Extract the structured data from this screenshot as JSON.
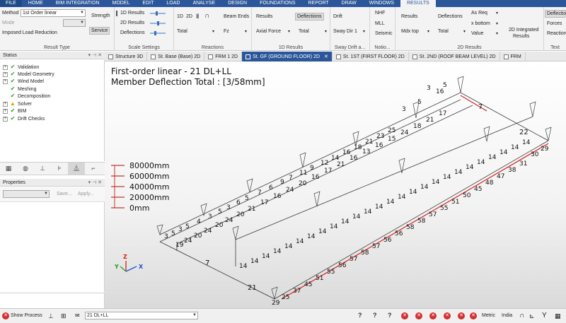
{
  "menu": [
    "FILE",
    "HOME",
    "BIM INTEGRATION",
    "MODEL",
    "EDIT",
    "LOAD",
    "ANALYSE",
    "DESIGN",
    "FOUNDATIONS",
    "REPORT",
    "DRAW",
    "WINDOWS",
    "RESULTS"
  ],
  "ribbon": {
    "result_type": {
      "method_label": "Method",
      "method_value": "1st Order linear",
      "mode_label": "Mode",
      "imposed_label": "Imposed Load Reduction",
      "strength": "Strength",
      "service": "Service",
      "group": "Result Type"
    },
    "scale": {
      "r1d": "1D Results",
      "r2d": "2D Results",
      "defl": "Deflections",
      "group": "Scale Settings"
    },
    "reactions": {
      "b1d": "1D",
      "b2d": "2D",
      "beam_ends": "Beam Ends",
      "total": "Total",
      "fz": "Fz",
      "group": "Reactions"
    },
    "res1d": {
      "results": "Results",
      "axial": "Axial Force",
      "deflections": "Deflections",
      "total": "Total",
      "group": "1D Results"
    },
    "drift": {
      "drift": "Drift",
      "sway": "Sway Dir 1",
      "group": "Sway Drift a..."
    },
    "notio": {
      "nhf": "NHF",
      "mll": "MLL",
      "seismic": "Seismic",
      "group": "Notio..."
    },
    "res2d": {
      "results": "Results",
      "mdx": "Mdx top",
      "deflections": "Deflections",
      "total": "Total",
      "as_req": "As Req",
      "xbottom": "x bottom",
      "value": "Value",
      "integrated": "2D Integrated",
      "integrated2": "Results",
      "group": "2D Results"
    },
    "text": {
      "deflections": "Deflections",
      "forces": "Forces",
      "reactions": "Reactions",
      "group": "Text"
    }
  },
  "status_panel": {
    "title": "Status",
    "items": [
      {
        "label": "Validation",
        "state": "expand"
      },
      {
        "label": "Model Geometry",
        "state": "ok"
      },
      {
        "label": "Wind Model",
        "state": "expand"
      },
      {
        "label": "Meshing",
        "state": "ok"
      },
      {
        "label": "Decomposition",
        "state": "ok"
      },
      {
        "label": "Solver",
        "state": "warn"
      },
      {
        "label": "BIM",
        "state": "ok"
      },
      {
        "label": "Drift Checks",
        "state": "expand"
      }
    ]
  },
  "properties_panel": {
    "title": "Properties",
    "save": "Save...",
    "apply": "Apply..."
  },
  "tabs": [
    {
      "label": "Structure 3D",
      "active": false
    },
    {
      "label": "St. Base (Base) 2D",
      "active": false
    },
    {
      "label": "FRM 1 2D",
      "active": false
    },
    {
      "label": "St. GF (GROUND FLOOR) 2D",
      "active": true
    },
    {
      "label": "St. 1ST (FIRST FLOOR) 2D",
      "active": false
    },
    {
      "label": "St. 2ND (ROOF BEAM LEVEL) 2D",
      "active": false
    },
    {
      "label": "FRM",
      "active": false
    }
  ],
  "viewport": {
    "title_line1": "First-order linear - 21 DL+LL",
    "title_line2": "Member Deflection Total : [3/58mm]",
    "scale": [
      "80000mm",
      "60000mm",
      "40000mm",
      "20000mm",
      "0mm"
    ],
    "axes": {
      "x": "X",
      "y": "Y",
      "z": "Z"
    },
    "big_labels": [
      "7",
      "21",
      "22",
      "7",
      "16"
    ],
    "back_row_labels": [
      "3",
      "5",
      "3",
      "5",
      "4",
      "3",
      "5",
      "3",
      "6",
      "5",
      "7",
      "6",
      "9",
      "7",
      "11",
      "9",
      "12",
      "14",
      "16",
      "18",
      "21",
      "23",
      "25",
      "2",
      "3"
    ],
    "front_row_labels": [
      "29",
      "25",
      "37",
      "45",
      "51",
      "55",
      "56",
      "57",
      "58",
      "57",
      "56",
      "55",
      "51",
      "45",
      "37",
      "29"
    ]
  },
  "statusbar": {
    "show_process": "Show Process",
    "combo": "21 DL+LL",
    "units": "Metric",
    "region": "India"
  },
  "colors": {
    "accent": "#2b579a",
    "deflected_member": "#d32020",
    "structure": "#3a3a3a"
  }
}
